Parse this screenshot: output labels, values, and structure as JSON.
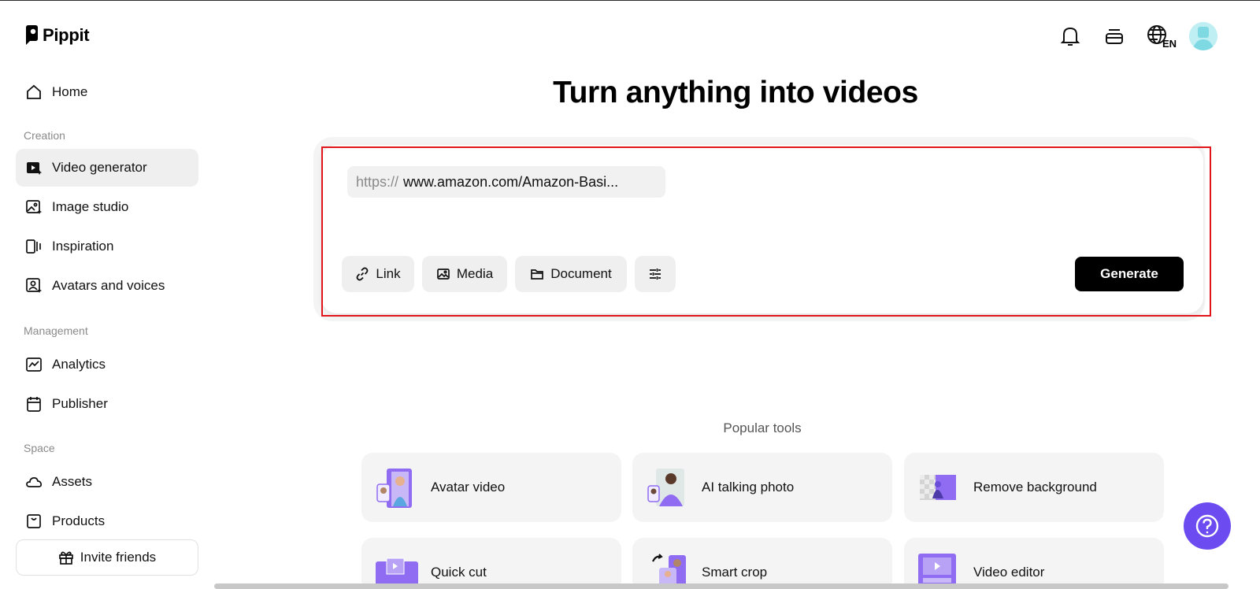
{
  "app": {
    "name": "Pippit"
  },
  "sidebar": {
    "home": {
      "label": "Home",
      "icon": "home-icon"
    },
    "sections": [
      {
        "title": "Creation"
      },
      {
        "title": "Management"
      },
      {
        "title": "Space"
      }
    ],
    "items": [
      {
        "label": "Video generator",
        "icon": "video-generator-icon",
        "active": true
      },
      {
        "label": "Image studio",
        "icon": "image-studio-icon"
      },
      {
        "label": "Inspiration",
        "icon": "inspiration-icon"
      },
      {
        "label": "Avatars and voices",
        "icon": "avatar-voice-icon"
      },
      {
        "label": "Analytics",
        "icon": "analytics-icon"
      },
      {
        "label": "Publisher",
        "icon": "calendar-icon"
      },
      {
        "label": "Assets",
        "icon": "cloud-icon"
      },
      {
        "label": "Products",
        "icon": "product-box-icon"
      }
    ],
    "invite": {
      "label": "Invite friends",
      "icon": "gift-icon"
    }
  },
  "header": {
    "icons": [
      "bell-icon",
      "card-stack-icon",
      "globe-icon",
      "avatar"
    ],
    "language": "EN"
  },
  "main": {
    "title": "Turn anything into videos",
    "url_input": {
      "prefix": "https://",
      "value": "www.amazon.com/Amazon-Basi..."
    },
    "tools": [
      {
        "label": "Link",
        "icon": "link-icon"
      },
      {
        "label": "Media",
        "icon": "image-icon"
      },
      {
        "label": "Document",
        "icon": "folder-icon"
      },
      {
        "label": "",
        "icon": "settings-sliders-icon"
      }
    ],
    "generate_label": "Generate",
    "popular": {
      "title": "Popular tools",
      "cards": [
        {
          "label": "Avatar video"
        },
        {
          "label": "AI talking photo"
        },
        {
          "label": "Remove background"
        },
        {
          "label": "Quick cut"
        },
        {
          "label": "Smart crop"
        },
        {
          "label": "Video editor"
        }
      ]
    }
  },
  "colors": {
    "accent": "#6c4cf0",
    "highlight": "#e0161b",
    "primary_button": "#000000",
    "thumb_purple": "#8f6cf2"
  }
}
